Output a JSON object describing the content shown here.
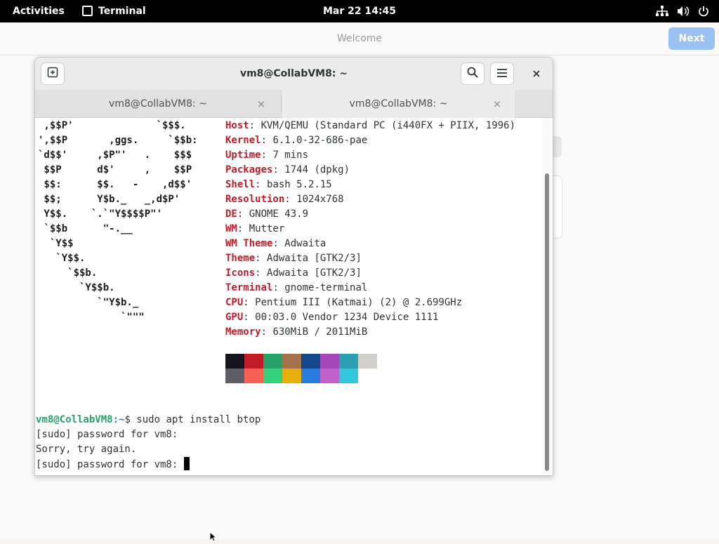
{
  "topbar": {
    "activities": "Activities",
    "app_name": "Terminal",
    "clock": "Mar 22  14:45",
    "icons": [
      "network-icon",
      "volume-icon",
      "power-icon"
    ]
  },
  "welcome": {
    "title": "Welcome",
    "next_label": "Next"
  },
  "terminal": {
    "title": "vm8@CollabVM8: ~",
    "tabs": [
      {
        "label": "vm8@CollabVM8: ~",
        "active": false
      },
      {
        "label": "vm8@CollabVM8: ~",
        "active": true
      }
    ],
    "close_symbol": "×",
    "logo": [
      " ,$$P'              `$$$.",
      "',$$P       ,ggs.     `$$b:",
      "`d$$'     ,$P\"'   .    $$$",
      " $$P      d$'     ,    $$P",
      " $$:      $$.   -    ,d$$'",
      " $$;      Y$b._   _,d$P'",
      " Y$$.    `.`\"Y$$$$P\"'",
      " `$$b      \"-.__",
      "  `Y$$",
      "   `Y$$.",
      "     `$$b.",
      "       `Y$$b.",
      "          `\"Y$b._",
      "              `\"\"\""
    ],
    "info": [
      {
        "key": "Host",
        "value": "KVM/QEMU (Standard PC (i440FX + PIIX, 1996)"
      },
      {
        "key": "Kernel",
        "value": "6.1.0-32-686-pae"
      },
      {
        "key": "Uptime",
        "value": "7 mins"
      },
      {
        "key": "Packages",
        "value": "1744 (dpkg)"
      },
      {
        "key": "Shell",
        "value": "bash 5.2.15"
      },
      {
        "key": "Resolution",
        "value": "1024x768"
      },
      {
        "key": "DE",
        "value": "GNOME 43.9"
      },
      {
        "key": "WM",
        "value": "Mutter"
      },
      {
        "key": "WM Theme",
        "value": "Adwaita"
      },
      {
        "key": "Theme",
        "value": "Adwaita [GTK2/3]"
      },
      {
        "key": "Icons",
        "value": "Adwaita [GTK2/3]"
      },
      {
        "key": "Terminal",
        "value": "gnome-terminal"
      },
      {
        "key": "CPU",
        "value": "Pentium III (Katmai) (2) @ 2.699GHz"
      },
      {
        "key": "GPU",
        "value": "00:03.0 Vendor 1234 Device 1111"
      },
      {
        "key": "Memory",
        "value": "630MiB / 2011MiB"
      }
    ],
    "palette_row1": [
      "#171421",
      "#c01c28",
      "#26a269",
      "#a2734c",
      "#12488b",
      "#a347ba",
      "#2aa1b3",
      "#d0cfcc"
    ],
    "palette_row2": [
      "#5e5c64",
      "#f66151",
      "#33d17a",
      "#e9ad0c",
      "#2a7bde",
      "#c061cb",
      "#33c7de",
      "#ffffff"
    ],
    "prompt_user": "vm8@CollabVM8",
    "prompt_path": ":~",
    "prompt_command": "$ sudo apt install btop",
    "output": [
      "[sudo] password for vm8:",
      "Sorry, try again.",
      "[sudo] password for vm8: "
    ]
  }
}
